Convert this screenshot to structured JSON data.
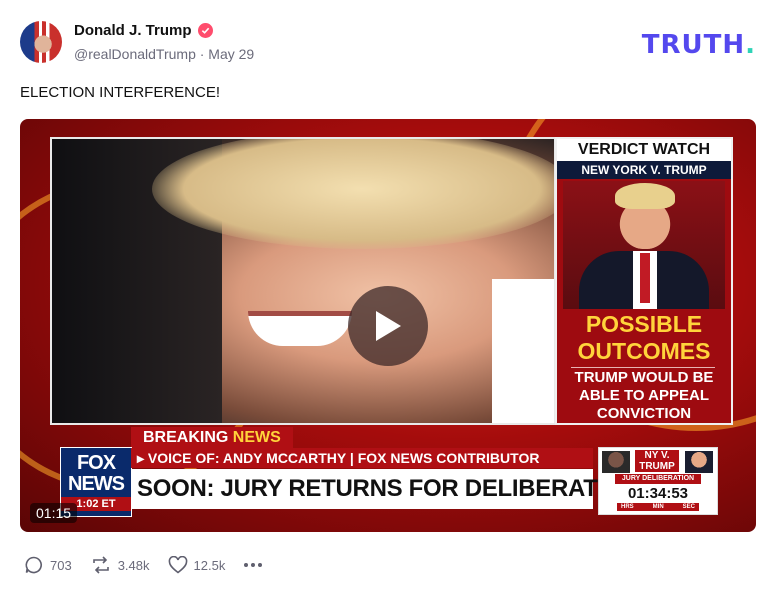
{
  "post": {
    "display_name": "Donald J. Trump",
    "handle_date": "@realDonaldTrump · May 29",
    "text": "ELECTION INTERFERENCE!"
  },
  "brand": {
    "logo_text": "TRUTH",
    "logo_dot": ".",
    "logo_color": "#5448ee",
    "dot_color": "#2ed3b7"
  },
  "video": {
    "duration": "01:15",
    "verdict_title": "VERDICT WATCH",
    "verdict_subtitle": "NEW YORK V. TRUMP",
    "possible_line1": "POSSIBLE",
    "possible_line2": "OUTCOMES",
    "appeal_line1": "TRUMP WOULD BE",
    "appeal_line2": "ABLE TO APPEAL",
    "appeal_line3": "CONVICTION",
    "breaking": "BREAKING",
    "breaking_news": "NEWS",
    "voice_of": "▸ VOICE OF: ANDY MCCARTHY | FOX NEWS CONTRIBUTOR",
    "headline": "SOON: JURY RETURNS FOR DELIBERATIONS",
    "fox_line1": "FOX",
    "fox_line2": "NEWS",
    "fox_time": "1:02 ET",
    "nyv_line1": "NY V.",
    "nyv_line2": "TRUMP",
    "jury_label": "JURY DELIBERATION",
    "timer": "01:34:53",
    "unit_hrs": "HRS",
    "unit_min": "MIN",
    "unit_sec": "SEC"
  },
  "actions": {
    "replies": "703",
    "retruths": "3.48k",
    "likes": "12.5k"
  }
}
